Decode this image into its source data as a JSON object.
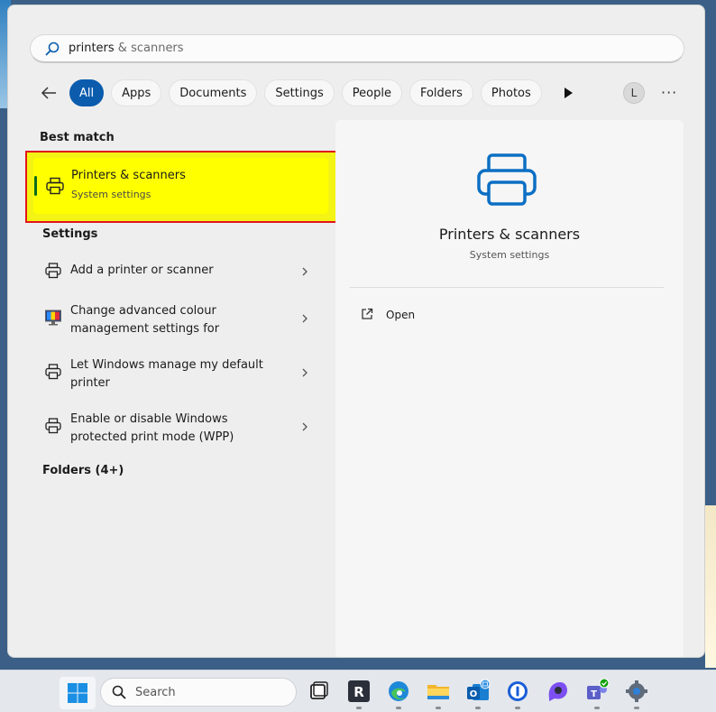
{
  "search": {
    "query_typed": "printers",
    "query_rest": " & scanners"
  },
  "filters": {
    "chips": [
      "All",
      "Apps",
      "Documents",
      "Settings",
      "People",
      "Folders",
      "Photos"
    ],
    "active": "All",
    "avatar_letter": "L",
    "more": "···"
  },
  "best_match": {
    "header": "Best match",
    "title": "Printers & scanners",
    "subtitle": "System settings"
  },
  "settings": {
    "header": "Settings",
    "items": [
      {
        "line1": "Add a printer or scanner",
        "line2": ""
      },
      {
        "line1": "Change advanced colour",
        "line2": "management settings for"
      },
      {
        "line1": "Let Windows manage my default",
        "line2": "printer"
      },
      {
        "line1": "Enable or disable Windows",
        "line2": "protected print mode (WPP)"
      }
    ]
  },
  "folders": {
    "header": "Folders (4+)"
  },
  "preview": {
    "title": "Printers & scanners",
    "subtitle": "System settings",
    "action": "Open"
  },
  "taskbar": {
    "search_placeholder": "Search"
  },
  "colors": {
    "accent": "#0b5cad",
    "highlight": "#ffff00",
    "highlight_border": "#e0141b",
    "printer_icon": "#0b6fc4"
  }
}
